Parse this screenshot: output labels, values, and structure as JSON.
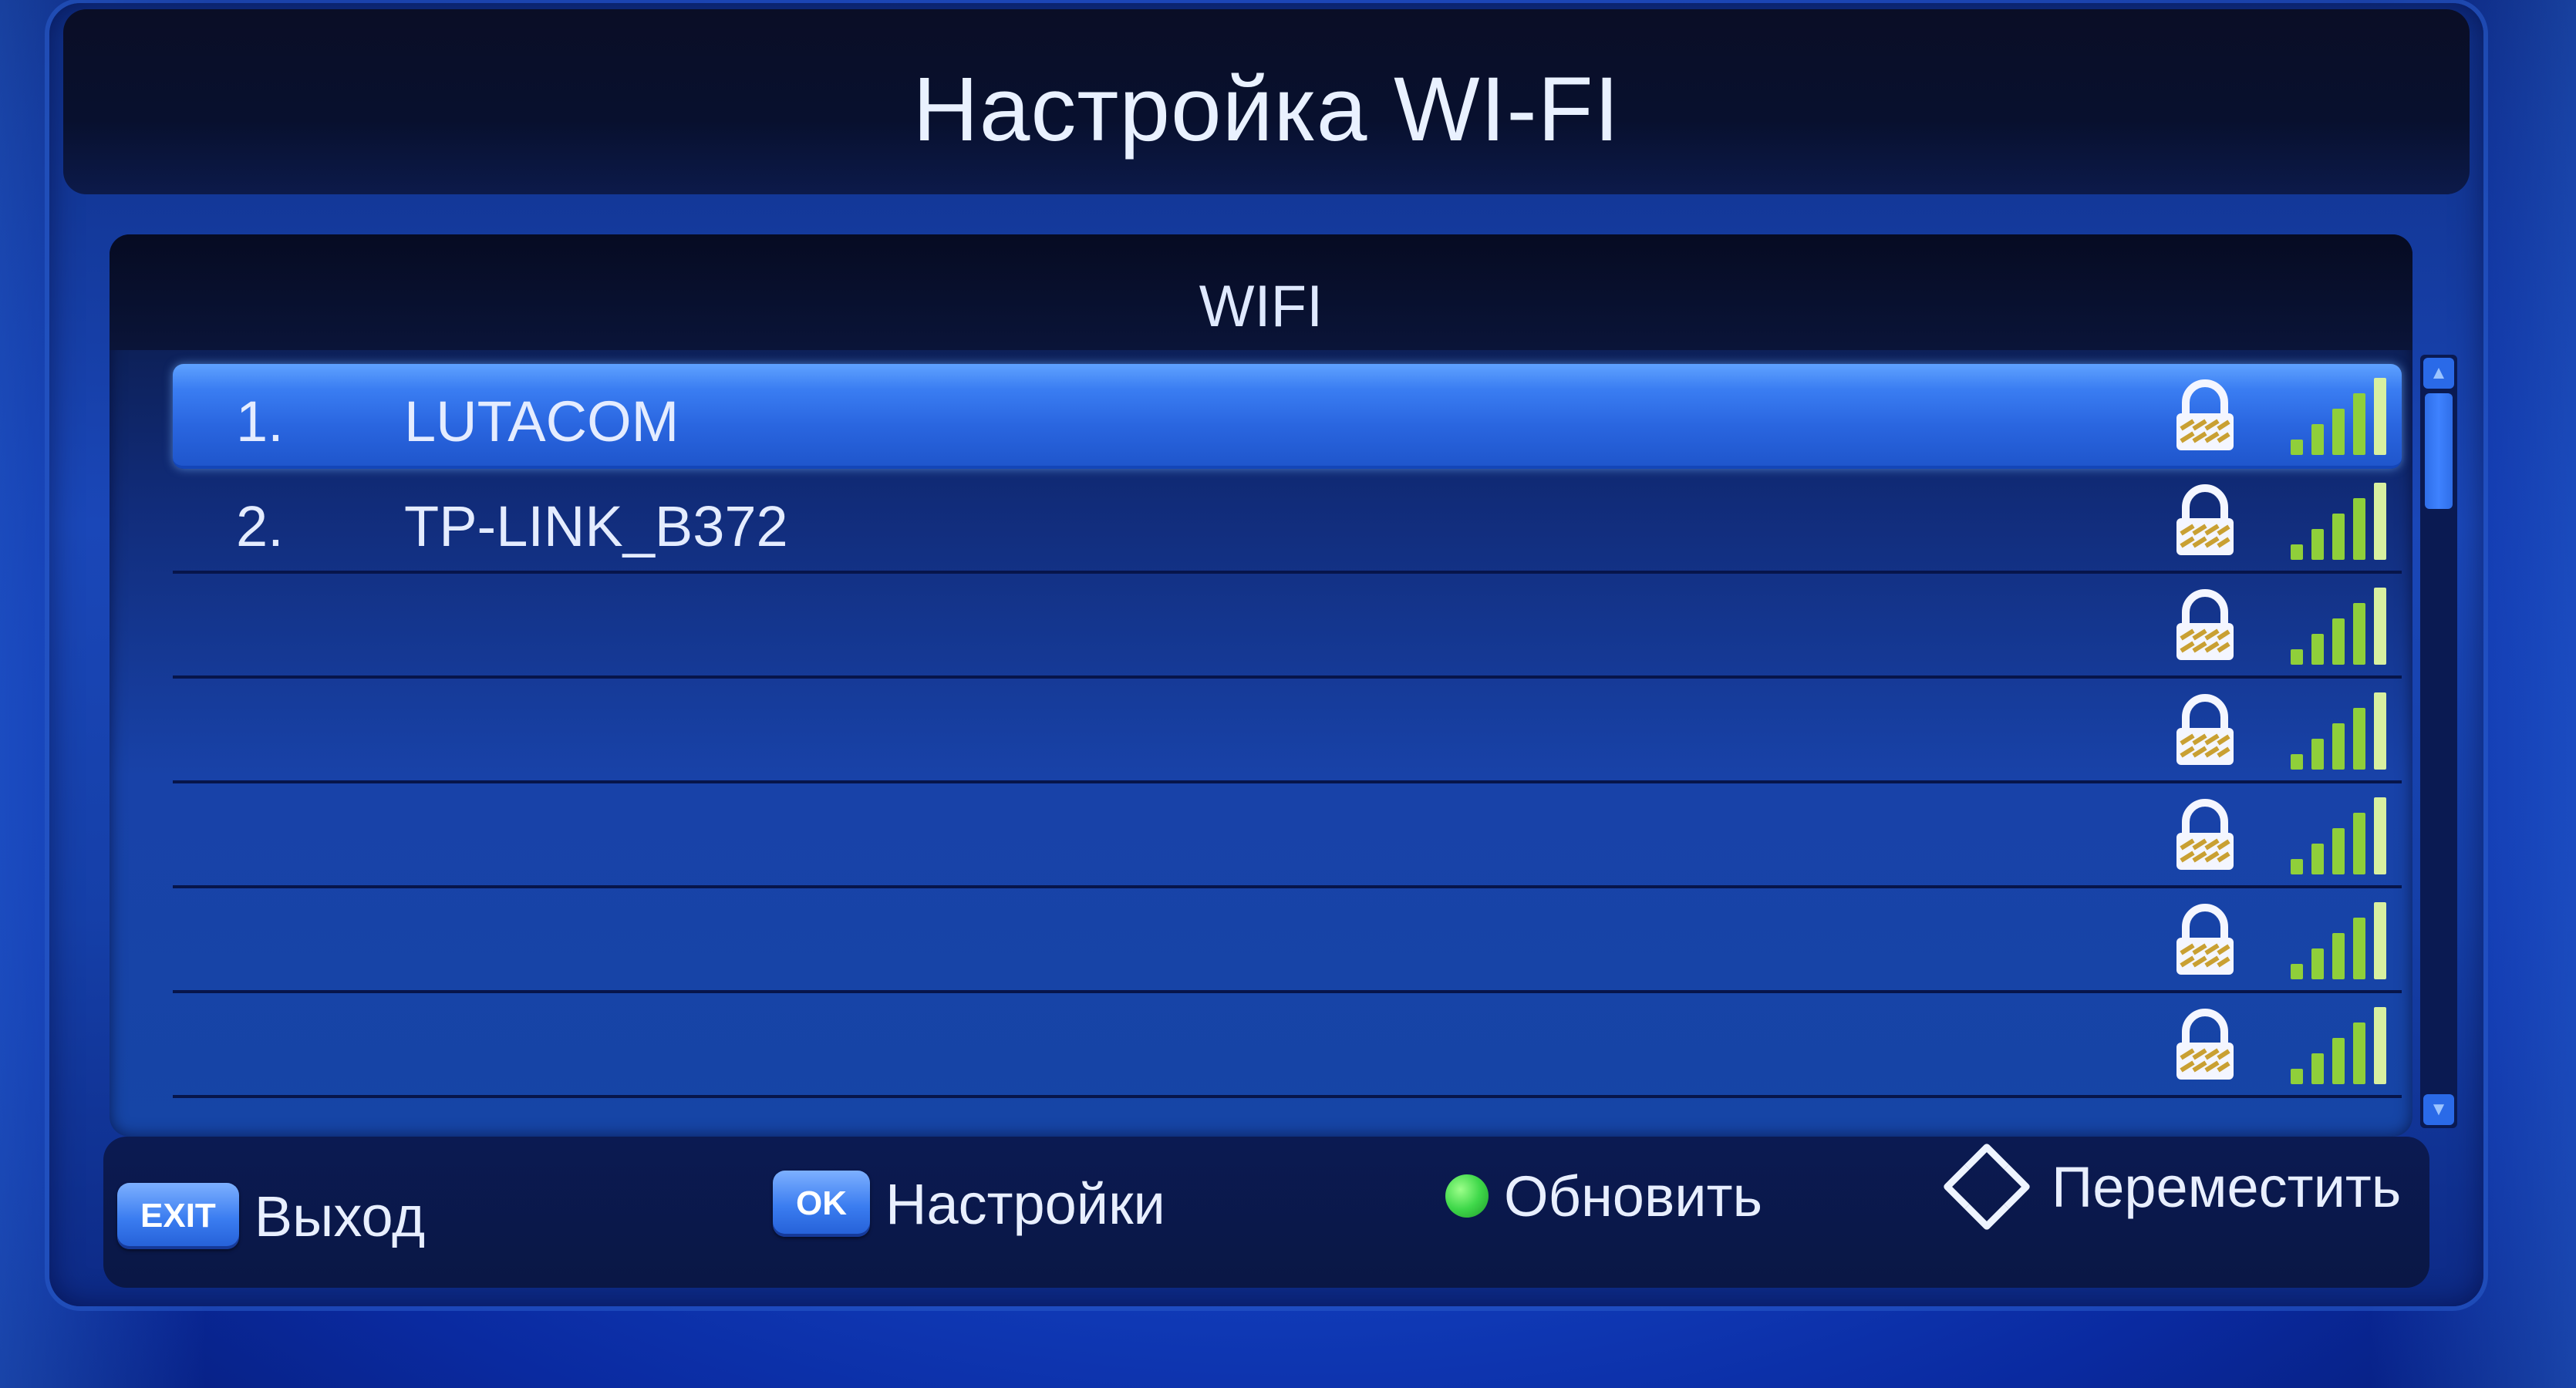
{
  "window": {
    "title": "Настройка WI-FI"
  },
  "list": {
    "header": "WIFI",
    "networks": [
      {
        "number": "1.",
        "name": "LUTACOM",
        "locked": true,
        "signal_bars": 5,
        "selected": true
      },
      {
        "number": "2.",
        "name": "TP-LINK_B372",
        "locked": true,
        "signal_bars": 5,
        "selected": false
      },
      {
        "number": "",
        "name": "",
        "locked": true,
        "signal_bars": 5,
        "selected": false
      },
      {
        "number": "",
        "name": "",
        "locked": true,
        "signal_bars": 5,
        "selected": false
      },
      {
        "number": "",
        "name": "",
        "locked": true,
        "signal_bars": 5,
        "selected": false
      },
      {
        "number": "",
        "name": "",
        "locked": true,
        "signal_bars": 5,
        "selected": false
      },
      {
        "number": "",
        "name": "",
        "locked": true,
        "signal_bars": 5,
        "selected": false
      }
    ]
  },
  "footer": {
    "exit_key": "EXIT",
    "exit_label": "Выход",
    "ok_key": "OK",
    "ok_label": "Настройки",
    "refresh_label": "Обновить",
    "move_label": "Переместить"
  },
  "colors": {
    "selected_row": "#3a7df2",
    "signal_bar": "#8fcf3a",
    "background": "#1446c8"
  },
  "icons": {
    "lock": "lock-icon",
    "signal": "signal-strength-icon",
    "refresh": "green-dot-icon",
    "move": "directional-arrows-icon"
  }
}
